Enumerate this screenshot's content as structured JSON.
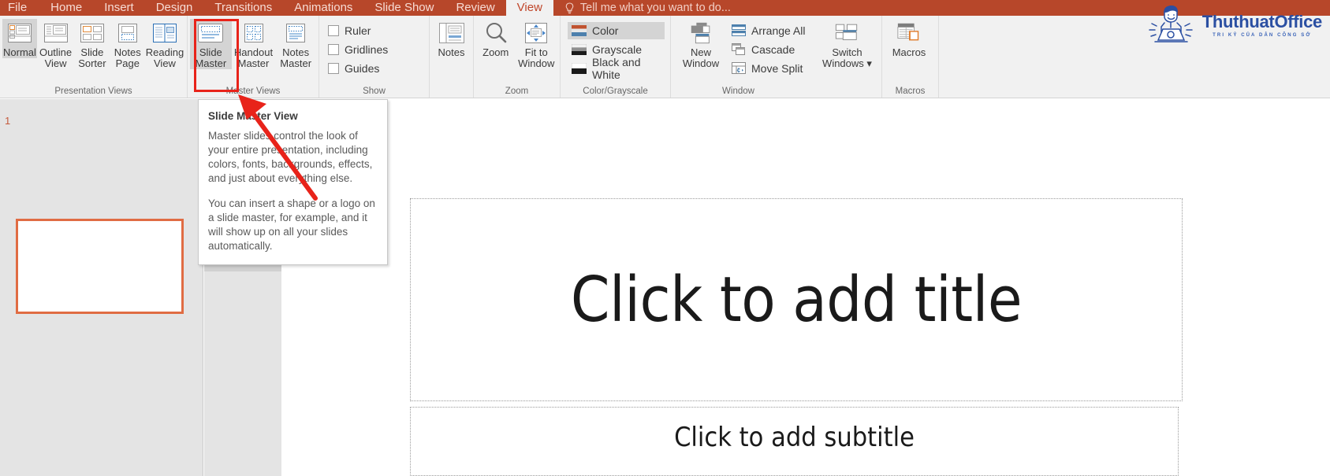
{
  "tabs": [
    {
      "label": "File",
      "active": false
    },
    {
      "label": "Home",
      "active": false
    },
    {
      "label": "Insert",
      "active": false
    },
    {
      "label": "Design",
      "active": false
    },
    {
      "label": "Transitions",
      "active": false
    },
    {
      "label": "Animations",
      "active": false
    },
    {
      "label": "Slide Show",
      "active": false
    },
    {
      "label": "Review",
      "active": false
    },
    {
      "label": "View",
      "active": true
    }
  ],
  "tellme": {
    "placeholder": "Tell me what you want to do...",
    "icon": "lightbulb-icon"
  },
  "watermark": {
    "title": "ThuthuatOffice",
    "tagline": "TRI KỶ CỦA DÂN CÔNG SỞ",
    "icon": "person-laptop-icon",
    "color": "#2b4fa2"
  },
  "ribbon": {
    "accent_color": "#b7472a",
    "groups": [
      {
        "name": "presentation-views",
        "label": "Presentation Views",
        "buttons": [
          {
            "label1": "Normal",
            "label2": "",
            "icon": "normal-view-icon",
            "selected": true
          },
          {
            "label1": "Outline",
            "label2": "View",
            "icon": "outline-view-icon",
            "selected": false
          },
          {
            "label1": "Slide",
            "label2": "Sorter",
            "icon": "slide-sorter-icon",
            "selected": false
          },
          {
            "label1": "Notes",
            "label2": "Page",
            "icon": "notes-page-icon",
            "selected": false
          },
          {
            "label1": "Reading",
            "label2": "View",
            "icon": "reading-view-icon",
            "selected": false
          }
        ]
      },
      {
        "name": "master-views",
        "label": "Master Views",
        "buttons": [
          {
            "label1": "Slide",
            "label2": "Master",
            "icon": "slide-master-icon",
            "selected": true
          },
          {
            "label1": "Handout",
            "label2": "Master",
            "icon": "handout-master-icon",
            "selected": false
          },
          {
            "label1": "Notes",
            "label2": "Master",
            "icon": "notes-master-icon",
            "selected": false
          }
        ]
      },
      {
        "name": "show",
        "label": "Show",
        "has_dialog_launcher": true,
        "checkboxes": [
          {
            "label": "Ruler",
            "checked": false
          },
          {
            "label": "Gridlines",
            "checked": false
          },
          {
            "label": "Guides",
            "checked": false
          }
        ],
        "buttons": [
          {
            "label1": "Notes",
            "label2": "",
            "icon": "notes-icon",
            "selected": false
          }
        ]
      },
      {
        "name": "zoom",
        "label": "Zoom",
        "buttons": [
          {
            "label1": "Zoom",
            "label2": "",
            "icon": "magnifier-icon",
            "selected": false
          },
          {
            "label1": "Fit to",
            "label2": "Window",
            "icon": "fit-to-window-icon",
            "selected": false
          }
        ]
      },
      {
        "name": "color-grayscale",
        "label": "Color/Grayscale",
        "rows": [
          {
            "label": "Color",
            "icon": "color-swatch-icon",
            "selected": true
          },
          {
            "label": "Grayscale",
            "icon": "grayscale-swatch-icon",
            "selected": false
          },
          {
            "label": "Black and White",
            "icon": "blackwhite-swatch-icon",
            "selected": false
          }
        ]
      },
      {
        "name": "window",
        "label": "Window",
        "buttons": [
          {
            "label1": "New",
            "label2": "Window",
            "icon": "new-window-icon",
            "selected": false
          }
        ],
        "rows": [
          {
            "label": "Arrange All",
            "icon": "arrange-all-icon",
            "selected": false
          },
          {
            "label": "Cascade",
            "icon": "cascade-icon",
            "selected": false
          },
          {
            "label": "Move Split",
            "icon": "move-split-icon",
            "selected": false
          }
        ],
        "buttons2": [
          {
            "label1": "Switch",
            "label2": "Windows ▾",
            "icon": "switch-windows-icon",
            "selected": false
          }
        ]
      },
      {
        "name": "macros",
        "label": "Macros",
        "buttons": [
          {
            "label1": "Macros",
            "label2": "",
            "icon": "macros-icon",
            "selected": false
          }
        ]
      }
    ]
  },
  "highlight": {
    "target": "slide-master-button",
    "color": "#e8231a"
  },
  "tooltip": {
    "title": "Slide Master View",
    "paragraph1": "Master slides control the look of your entire presentation, including colors, fonts, backgrounds, effects, and just about everything else.",
    "paragraph2": "You can insert a shape or a logo on a slide master, for example, and it will show up on all your slides automatically."
  },
  "annotation": {
    "type": "red-arrow",
    "color": "#e8231a",
    "points_to": "slide-master-button"
  },
  "thumbnails": {
    "slides": [
      {
        "number": "1",
        "selected": true
      }
    ]
  },
  "slide": {
    "title_placeholder": "Click to add title",
    "subtitle_placeholder": "Click to add subtitle"
  }
}
